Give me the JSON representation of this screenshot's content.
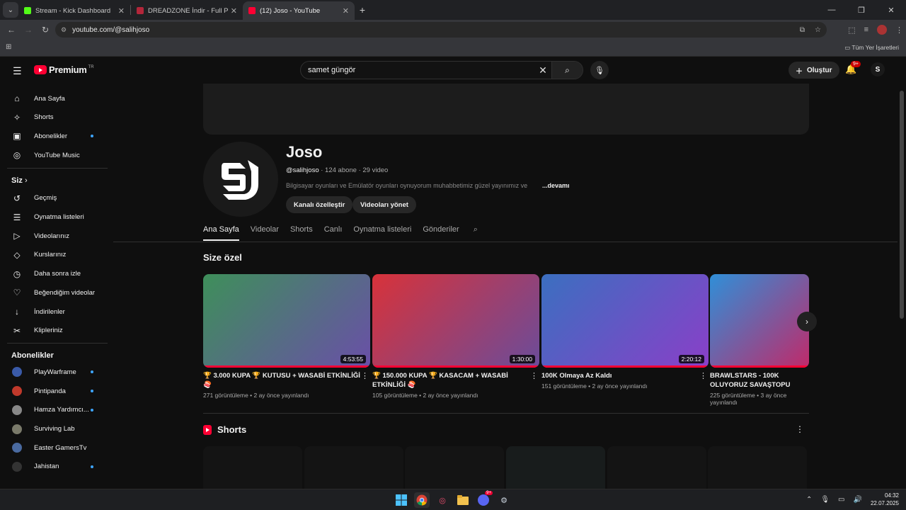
{
  "browser": {
    "tabs": [
      {
        "title": "Stream - Kick Dashboard",
        "fav_color": "#53fc18",
        "active": false
      },
      {
        "title": "DREADZONE İndir - Full PC + T",
        "fav_color": "#b3263a",
        "active": false
      },
      {
        "title": "(12) Joso - YouTube",
        "fav_color": "#ff0033",
        "active": true
      }
    ],
    "url": "youtube.com/@salihjoso",
    "bookmarks_all": "Tüm Yer İşaretleri"
  },
  "yt": {
    "logo_text": "Premium",
    "logo_cc": "TR",
    "search_query": "samet güngör",
    "create_label": "Oluştur",
    "notif_badge": "9+",
    "sidebar": {
      "main": [
        {
          "label": "Ana Sayfa",
          "icon": "home-icon",
          "glyph": "⌂"
        },
        {
          "label": "Shorts",
          "icon": "shorts-icon",
          "glyph": "✧"
        },
        {
          "label": "Abonelikler",
          "icon": "subscriptions-icon",
          "glyph": "▣",
          "dot": true
        },
        {
          "label": "YouTube Music",
          "icon": "music-icon",
          "glyph": "◎"
        }
      ],
      "you_header": "Siz",
      "you": [
        {
          "label": "Geçmiş",
          "icon": "history-icon",
          "glyph": "↺"
        },
        {
          "label": "Oynatma listeleri",
          "icon": "playlists-icon",
          "glyph": "☰"
        },
        {
          "label": "Videolarınız",
          "icon": "your-videos-icon",
          "glyph": "▷"
        },
        {
          "label": "Kurslarınız",
          "icon": "courses-icon",
          "glyph": "◇"
        },
        {
          "label": "Daha sonra izle",
          "icon": "watch-later-icon",
          "glyph": "◷"
        },
        {
          "label": "Beğendiğim videolar",
          "icon": "liked-icon",
          "glyph": "♡"
        },
        {
          "label": "İndirilenler",
          "icon": "downloads-icon",
          "glyph": "↓"
        },
        {
          "label": "Klipleriniz",
          "icon": "clips-icon",
          "glyph": "✂"
        }
      ],
      "subs_header": "Abonelikler",
      "subs": [
        {
          "label": "PlayWarframe",
          "color": "#3a5aa8",
          "dot": true
        },
        {
          "label": "Pintipanda",
          "color": "#c0392b",
          "dot": true
        },
        {
          "label": "Hamza Yardımcı...",
          "color": "#888888",
          "dot": true
        },
        {
          "label": "Surviving Lab",
          "color": "#7a7a6a",
          "dot": false
        },
        {
          "label": "Easter GamersTv",
          "color": "#4a6aa0",
          "dot": false
        },
        {
          "label": "Jahistan",
          "color": "#333333",
          "dot": true
        }
      ]
    },
    "channel": {
      "name": "Joso",
      "handle": "@salihjoso",
      "subs": " · 124 abone · 29 video",
      "description": "Bilgisayar oyunları ve Emülatör oyunları oynuyorum muhabbetimiz güzel yayınımız ve",
      "more": "...devamı",
      "btn_customize": "Kanalı özelleştir",
      "btn_manage": "Videoları yönet",
      "tabs": [
        "Ana Sayfa",
        "Videolar",
        "Shorts",
        "Canlı",
        "Oynatma listeleri",
        "Gönderiler"
      ]
    },
    "for_you_title": "Size özel",
    "videos": [
      {
        "title": "🏆 3.000 KUPA 🏆 KUTUSU + WASABİ ETKİNLİĞİ 🍣",
        "meta": "271 görüntüleme • 2 ay önce yayınlandı",
        "duration": "4:53:55",
        "c1": "#3e8f5a",
        "c2": "#6a4fa8"
      },
      {
        "title": "🏆 150.000 KUPA 🏆 KASACAM + WASABİ ETKİNLİĞİ 🍣",
        "meta": "105 görüntüleme • 2 ay önce yayınlandı",
        "duration": "1:30:00",
        "c1": "#d8323a",
        "c2": "#6b4c9a"
      },
      {
        "title": "100K Olmaya Az Kaldı",
        "meta": "151 görüntüleme • 2 ay önce yayınlandı",
        "duration": "2:20:12",
        "c1": "#3b6fc0",
        "c2": "#8a3fc8"
      },
      {
        "title": "BRAWLSTARS - 100K OLUYORUZ SAVAŞTOPU",
        "meta": "225 görüntüleme • 3 ay önce yayınlandı",
        "duration": "",
        "c1": "#2f8fd8",
        "c2": "#c02a6a"
      }
    ],
    "shorts_title": "Shorts"
  },
  "taskbar": {
    "time": "04:32",
    "date": "22.07.2025",
    "discord_badge": "9+"
  }
}
